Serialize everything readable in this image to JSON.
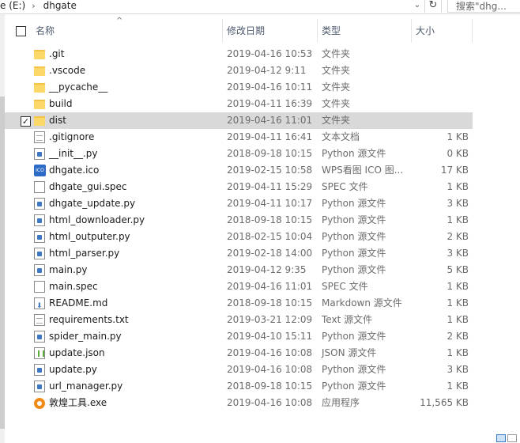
{
  "address": {
    "drive": "e (E:)",
    "folder": "dhgate",
    "search_placeholder": "搜索\"dhg..."
  },
  "columns": {
    "name": "名称",
    "date": "修改日期",
    "type": "类型",
    "size": "大小"
  },
  "files": [
    {
      "name": ".git",
      "date": "2019-04-16 10:53",
      "type": "文件夹",
      "size": "",
      "icon": "folder-icon",
      "checked": false
    },
    {
      "name": ".vscode",
      "date": "2019-04-12 9:11",
      "type": "文件夹",
      "size": "",
      "icon": "folder-icon",
      "checked": false
    },
    {
      "name": "__pycache__",
      "date": "2019-04-16 10:11",
      "type": "文件夹",
      "size": "",
      "icon": "folder-icon",
      "checked": false
    },
    {
      "name": "build",
      "date": "2019-04-11 16:39",
      "type": "文件夹",
      "size": "",
      "icon": "folder-icon",
      "checked": false
    },
    {
      "name": "dist",
      "date": "2019-04-16 11:01",
      "type": "文件夹",
      "size": "",
      "icon": "folder-icon",
      "checked": true
    },
    {
      "name": ".gitignore",
      "date": "2019-04-11 16:41",
      "type": "文本文档",
      "size": "1 KB",
      "icon": "text-file-icon",
      "checked": false
    },
    {
      "name": "__init__.py",
      "date": "2018-09-18 10:15",
      "type": "Python 源文件",
      "size": "0 KB",
      "icon": "python-file-icon",
      "checked": false
    },
    {
      "name": "dhgate.ico",
      "date": "2019-02-15 10:58",
      "type": "WPS看图 ICO 图...",
      "size": "17 KB",
      "icon": "ico-file-icon",
      "checked": false
    },
    {
      "name": "dhgate_gui.spec",
      "date": "2019-04-11 15:29",
      "type": "SPEC 文件",
      "size": "1 KB",
      "icon": "blank-file-icon",
      "checked": false
    },
    {
      "name": "dhgate_update.py",
      "date": "2019-04-11 10:17",
      "type": "Python 源文件",
      "size": "3 KB",
      "icon": "python-file-icon",
      "checked": false
    },
    {
      "name": "html_downloader.py",
      "date": "2018-09-18 10:15",
      "type": "Python 源文件",
      "size": "1 KB",
      "icon": "python-file-icon",
      "checked": false
    },
    {
      "name": "html_outputer.py",
      "date": "2018-02-15 10:04",
      "type": "Python 源文件",
      "size": "2 KB",
      "icon": "python-file-icon",
      "checked": false
    },
    {
      "name": "html_parser.py",
      "date": "2019-02-18 14:00",
      "type": "Python 源文件",
      "size": "3 KB",
      "icon": "python-file-icon",
      "checked": false
    },
    {
      "name": "main.py",
      "date": "2019-04-12 9:35",
      "type": "Python 源文件",
      "size": "5 KB",
      "icon": "python-file-icon",
      "checked": false
    },
    {
      "name": "main.spec",
      "date": "2019-04-16 11:01",
      "type": "SPEC 文件",
      "size": "1 KB",
      "icon": "blank-file-icon",
      "checked": false
    },
    {
      "name": "README.md",
      "date": "2018-09-18 10:15",
      "type": "Markdown 源文件",
      "size": "1 KB",
      "icon": "markdown-file-icon",
      "checked": false
    },
    {
      "name": "requirements.txt",
      "date": "2019-03-21 12:09",
      "type": "Text 源文件",
      "size": "1 KB",
      "icon": "text-file-icon",
      "checked": false
    },
    {
      "name": "spider_main.py",
      "date": "2019-04-10 15:11",
      "type": "Python 源文件",
      "size": "2 KB",
      "icon": "python-file-icon",
      "checked": false
    },
    {
      "name": "update.json",
      "date": "2019-04-16 10:08",
      "type": "JSON 源文件",
      "size": "1 KB",
      "icon": "json-file-icon",
      "checked": false
    },
    {
      "name": "update.py",
      "date": "2019-04-16 10:08",
      "type": "Python 源文件",
      "size": "3 KB",
      "icon": "python-file-icon",
      "checked": false
    },
    {
      "name": "url_manager.py",
      "date": "2018-09-18 10:15",
      "type": "Python 源文件",
      "size": "1 KB",
      "icon": "python-file-icon",
      "checked": false
    },
    {
      "name": "敦煌工具.exe",
      "date": "2019-04-16 10:08",
      "type": "应用程序",
      "size": "11,565 KB",
      "icon": "app-exe-icon",
      "checked": false
    }
  ],
  "selected_row": 4
}
